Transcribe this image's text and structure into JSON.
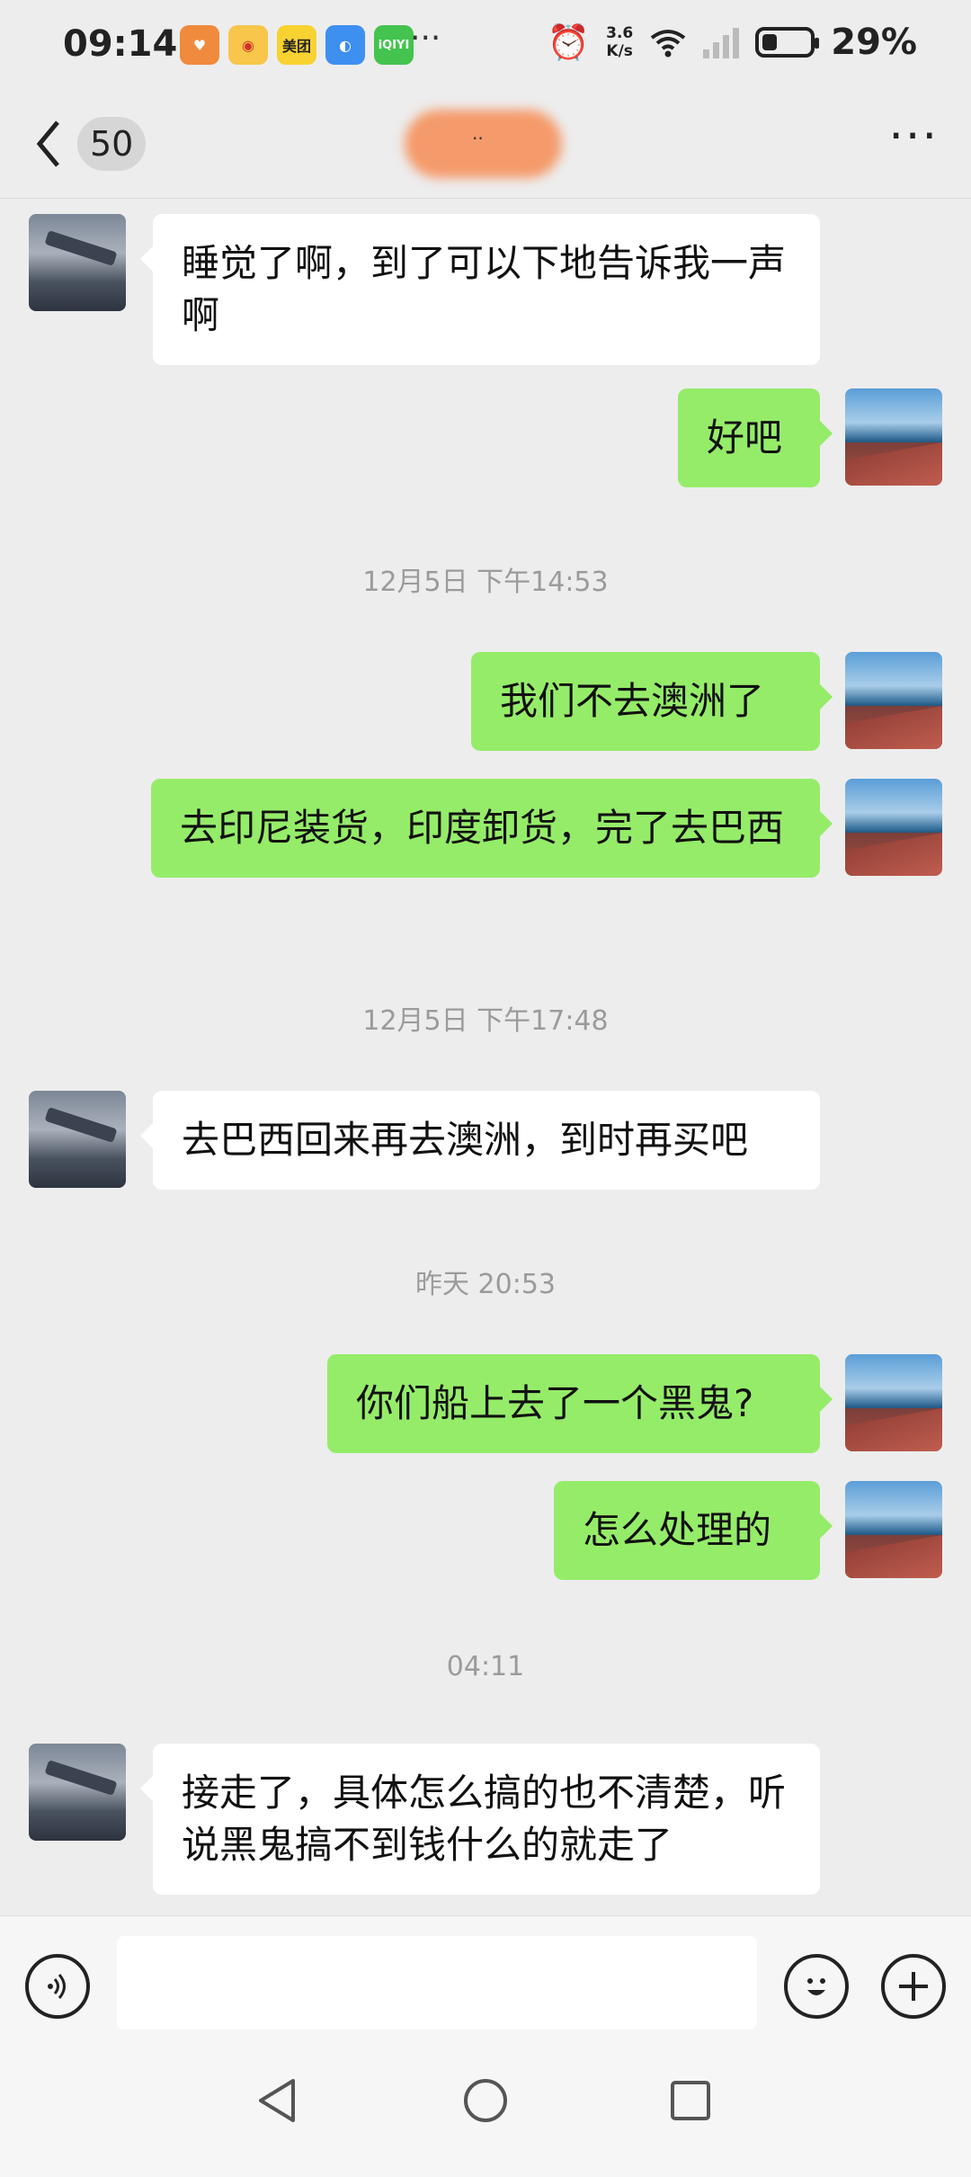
{
  "status_bar": {
    "time": "09:14",
    "app_icons": [
      {
        "name": "heart-app-icon",
        "label": "",
        "color": "#f08a3c"
      },
      {
        "name": "weibo-icon",
        "label": "",
        "color": "#f7c64a"
      },
      {
        "name": "meituan-icon",
        "label": "美团",
        "color": "#f7d231"
      },
      {
        "name": "browser-icon",
        "label": "",
        "color": "#3d8ff0"
      },
      {
        "name": "iqiyi-icon",
        "label": "iQIYI",
        "color": "#44c34f"
      }
    ],
    "net_speed_value": "3.6",
    "net_speed_unit": "K/s",
    "battery": "29%"
  },
  "header": {
    "back_count": "50",
    "contact_name_visible": "··",
    "menu_label": "···"
  },
  "messages": [
    {
      "side": "other",
      "text": "睡觉了啊，到了可以下地告诉我一声啊"
    },
    {
      "side": "me",
      "text": "好吧"
    },
    {
      "side": "time",
      "text": "12月5日 下午14:53"
    },
    {
      "side": "me",
      "text": "我们不去澳洲了"
    },
    {
      "side": "me",
      "text": "去印尼装货，印度卸货，完了去巴西"
    },
    {
      "side": "time",
      "text": "12月5日 下午17:48"
    },
    {
      "side": "other",
      "text": "去巴西回来再去澳洲，到时再买吧"
    },
    {
      "side": "time",
      "text": "昨天 20:53"
    },
    {
      "side": "me",
      "text": "你们船上去了一个黑鬼?"
    },
    {
      "side": "me",
      "text": "怎么处理的"
    },
    {
      "side": "time",
      "text": "04:11"
    },
    {
      "side": "other",
      "text": "接走了，具体怎么搞的也不清楚，听说黑鬼搞不到钱什么的就走了"
    }
  ],
  "input_bar": {
    "placeholder": ""
  }
}
